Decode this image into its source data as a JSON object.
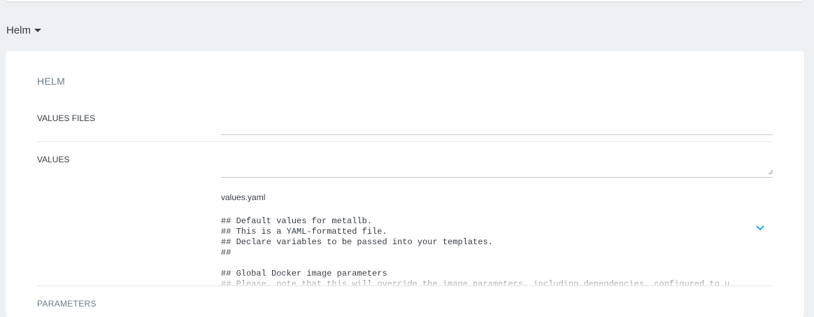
{
  "section": {
    "title": "Helm"
  },
  "card": {
    "title": "HELM",
    "values_files": {
      "label": "VALUES FILES",
      "value": ""
    },
    "values": {
      "label": "VALUES",
      "value": ""
    },
    "file": {
      "name": "values.yaml",
      "content": "## Default values for metallb.\n## This is a YAML-formatted file.\n## Declare variables to be passed into your templates.\n##\n\n## Global Docker image parameters\n## Please, note that this will override the image parameters, including dependencies, configured to u"
    },
    "parameters": {
      "label": "PARAMETERS"
    }
  },
  "colors": {
    "accent": "#0dadea",
    "border": "#c6ccd3",
    "background": "#eef1f4"
  },
  "icons": {
    "caret": "caret-down-icon",
    "expand": "chevron-down-icon",
    "resize": "resize-grip-icon"
  }
}
